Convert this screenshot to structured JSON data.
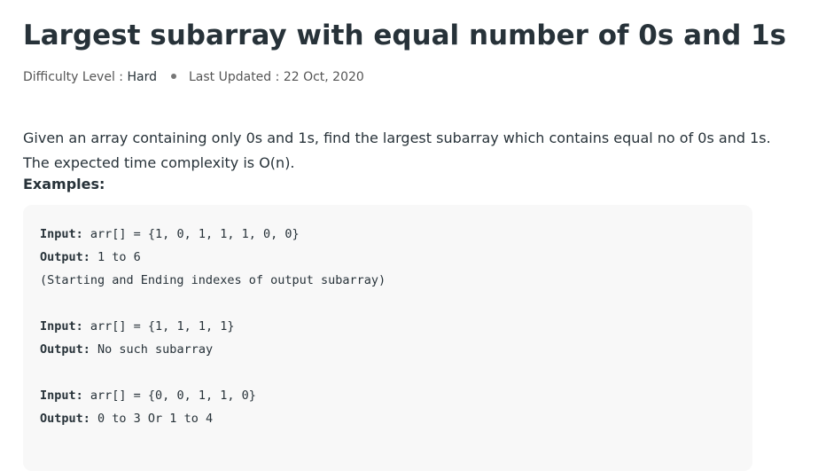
{
  "title": "Largest subarray with equal number of 0s and 1s",
  "meta": {
    "difficulty_label": "Difficulty Level :",
    "difficulty": "Hard",
    "updated_label": "Last Updated :",
    "updated": "22 Oct, 2020"
  },
  "description": "Given an array containing only 0s and 1s, find the largest subarray which contains equal no of 0s and 1s. The expected time complexity is O(n).",
  "examples_label": "Examples:",
  "code": [
    {
      "k": "Input:",
      "v": " arr[] = {1, 0, 1, 1, 1, 0, 0}"
    },
    {
      "k": "Output:",
      "v": " 1 to 6"
    },
    {
      "k": "",
      "v": "(Starting and Ending indexes of output subarray)"
    },
    {
      "k": "Input:",
      "v": " arr[] = {1, 1, 1, 1}"
    },
    {
      "k": "Output:",
      "v": " No such subarray"
    },
    {
      "k": "Input:",
      "v": " arr[] = {0, 0, 1, 1, 0}"
    },
    {
      "k": "Output:",
      "v": " 0 to 3 Or 1 to 4"
    }
  ]
}
